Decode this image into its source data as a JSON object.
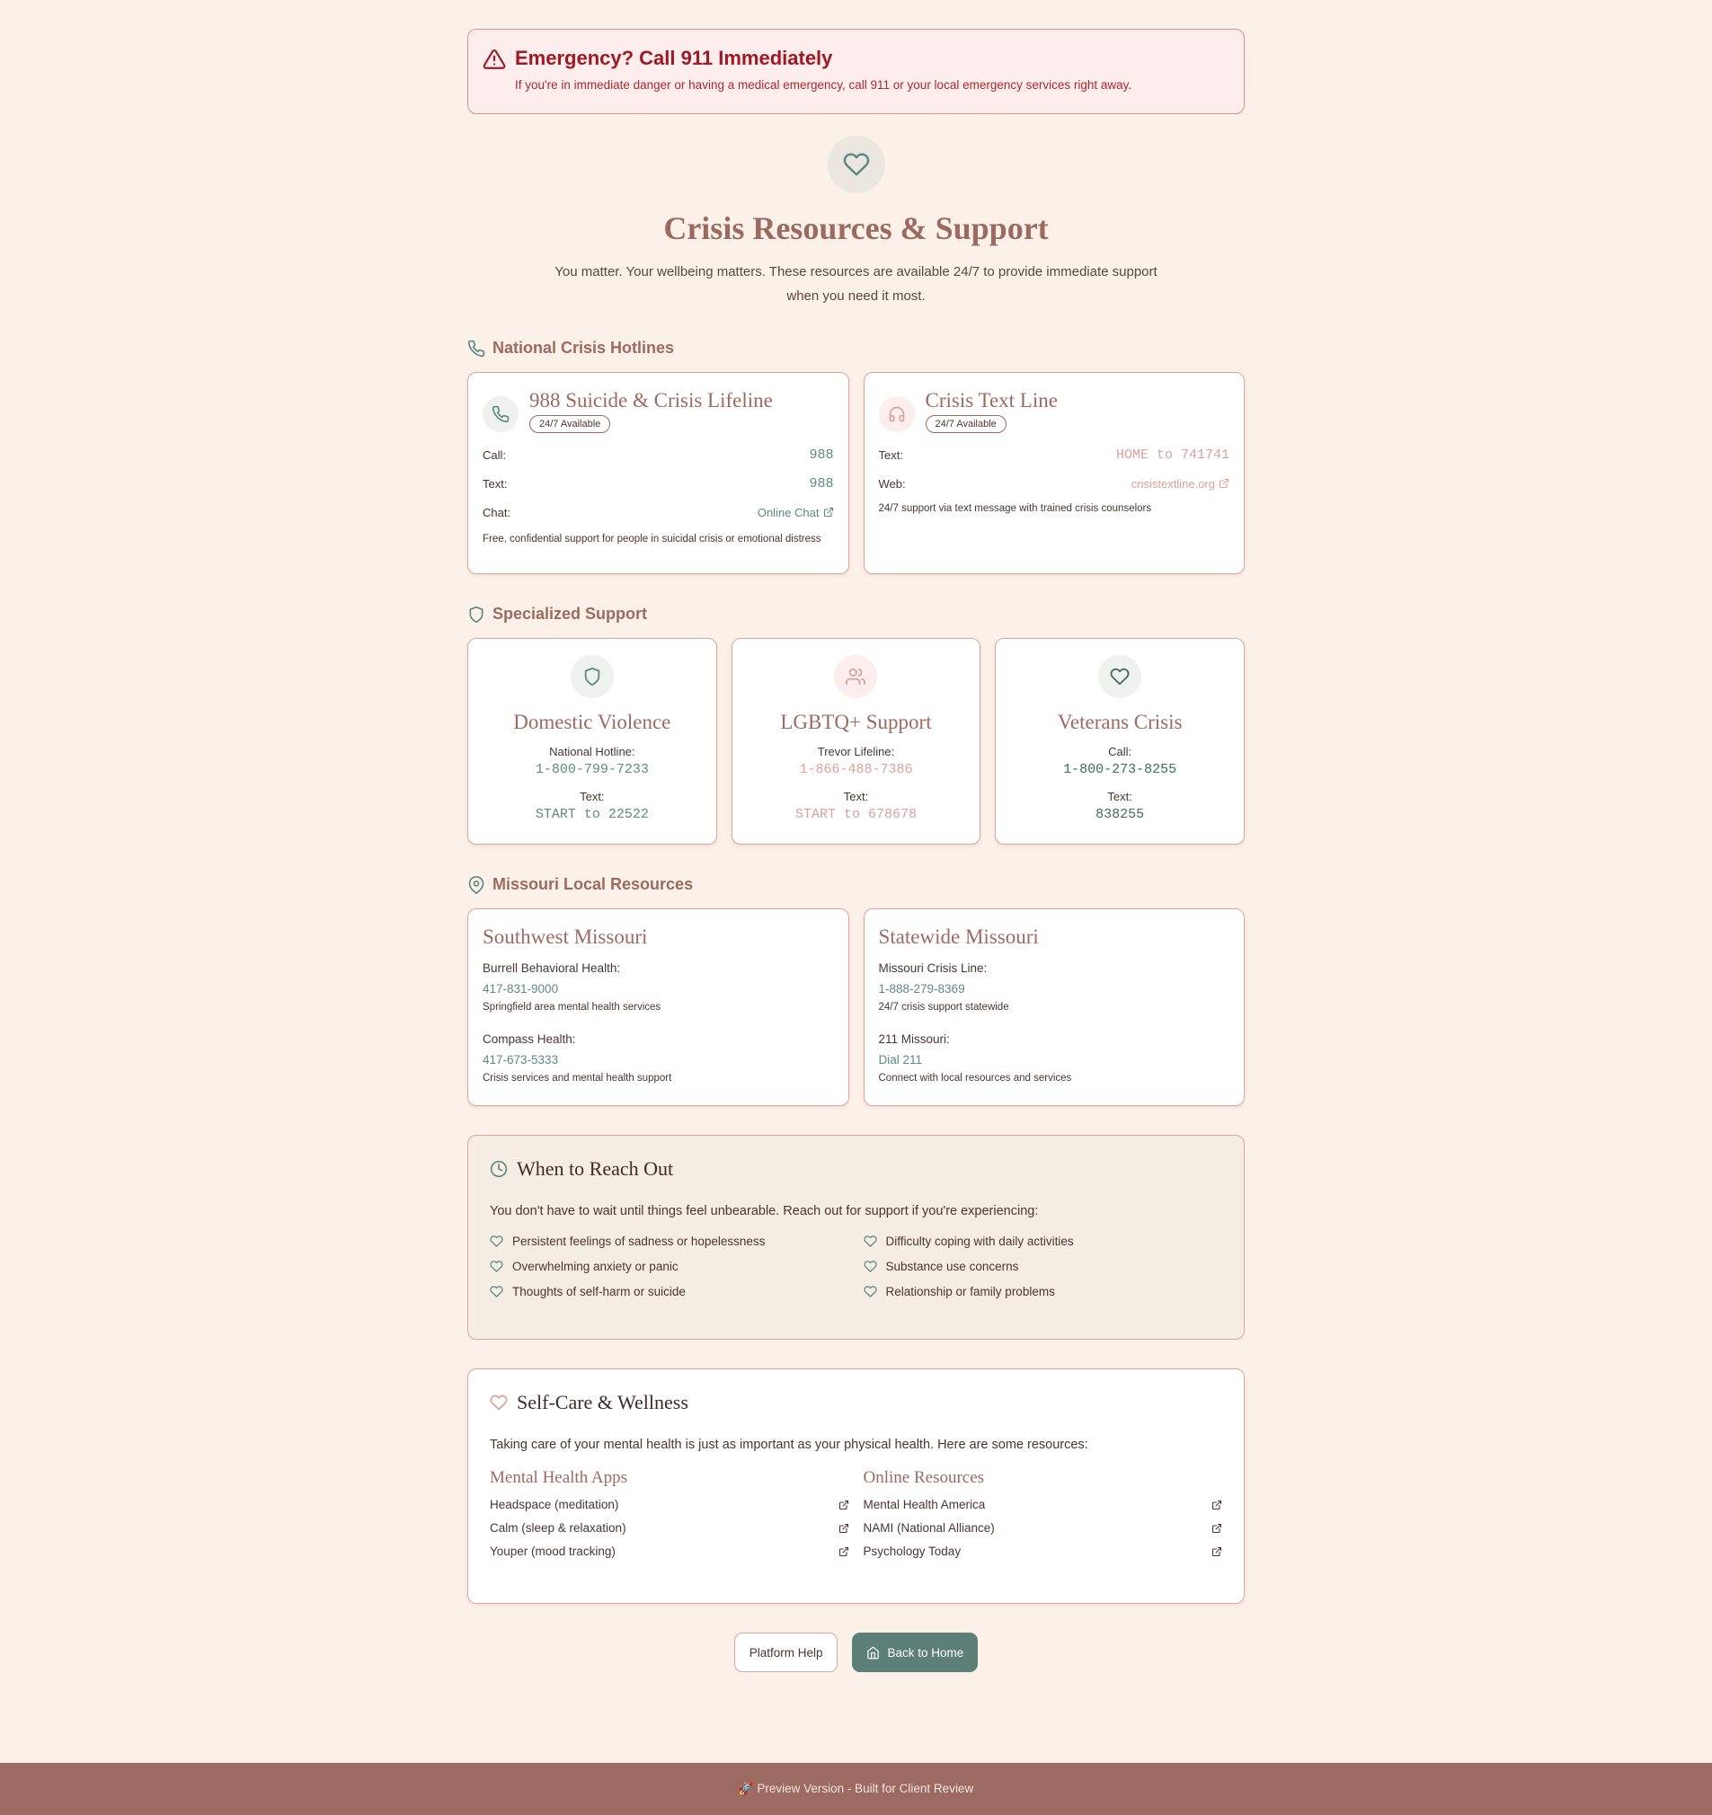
{
  "emergency": {
    "title": "Emergency? Call 911 Immediately",
    "text": "If you're in immediate danger or having a medical emergency, call 911 or your local emergency services right away."
  },
  "hero": {
    "title": "Crisis Resources & Support",
    "subtitle": "You matter. Your wellbeing matters. These resources are available 24/7 to provide immediate support when you need it most."
  },
  "hotlines": {
    "section_title": "National Crisis Hotlines",
    "lifeline": {
      "name": "988 Suicide & Crisis Lifeline",
      "badge": "24/7 Available",
      "call_label": "Call:",
      "call_value": "988",
      "text_label": "Text:",
      "text_value": "988",
      "chat_label": "Chat:",
      "chat_value": "Online Chat",
      "description": "Free, confidential support for people in suicidal crisis or emotional distress"
    },
    "textline": {
      "name": "Crisis Text Line",
      "badge": "24/7 Available",
      "text_label": "Text:",
      "text_value": "HOME to 741741",
      "web_label": "Web:",
      "web_value": "crisistextline.org",
      "description": "24/7 support via text message with trained crisis counselors"
    }
  },
  "specialized": {
    "section_title": "Specialized Support",
    "items": [
      {
        "title": "Domestic Violence",
        "label1": "National Hotline:",
        "value1": "1-800-799-7233",
        "label2": "Text:",
        "value2": "START to 22522"
      },
      {
        "title": "LGBTQ+ Support",
        "label1": "Trevor Lifeline:",
        "value1": "1-866-488-7386",
        "label2": "Text:",
        "value2": "START to 678678"
      },
      {
        "title": "Veterans Crisis",
        "label1": "Call:",
        "value1": "1-800-273-8255",
        "label2": "Text:",
        "value2": "838255"
      }
    ]
  },
  "local": {
    "section_title": "Missouri Local Resources",
    "southwest": {
      "title": "Southwest Missouri",
      "org1": "Burrell Behavioral Health:",
      "phone1": "417-831-9000",
      "note1": "Springfield area mental health services",
      "org2": "Compass Health:",
      "phone2": "417-673-5333",
      "note2": "Crisis services and mental health support"
    },
    "statewide": {
      "title": "Statewide Missouri",
      "org1": "Missouri Crisis Line:",
      "phone1": "1-888-279-8369",
      "note1": "24/7 crisis support statewide",
      "org2": "211 Missouri:",
      "phone2": "Dial 211",
      "note2": "Connect with local resources and services"
    }
  },
  "reach": {
    "title": "When to Reach Out",
    "intro": "You don't have to wait until things feel unbearable. Reach out for support if you're experiencing:",
    "items": [
      "Persistent feelings of sadness or hopelessness",
      "Difficulty coping with daily activities",
      "Overwhelming anxiety or panic",
      "Substance use concerns",
      "Thoughts of self-harm or suicide",
      "Relationship or family problems"
    ]
  },
  "selfcare": {
    "title": "Self-Care & Wellness",
    "intro": "Taking care of your mental health is just as important as your physical health. Here are some resources:",
    "apps_title": "Mental Health Apps",
    "apps": [
      "Headspace (meditation)",
      "Calm (sleep & relaxation)",
      "Youper (mood tracking)"
    ],
    "online_title": "Online Resources",
    "online": [
      "Mental Health America",
      "NAMI (National Alliance)",
      "Psychology Today"
    ]
  },
  "actions": {
    "help_label": "Platform Help",
    "home_label": "Back to Home"
  },
  "footer": {
    "text": "🚀 Preview Version - Built for Client Review"
  },
  "colors": {
    "background": "#fbf1e8",
    "accent": "#9c6a60",
    "teal": "#5c8a80",
    "emergency": "#a01822"
  }
}
